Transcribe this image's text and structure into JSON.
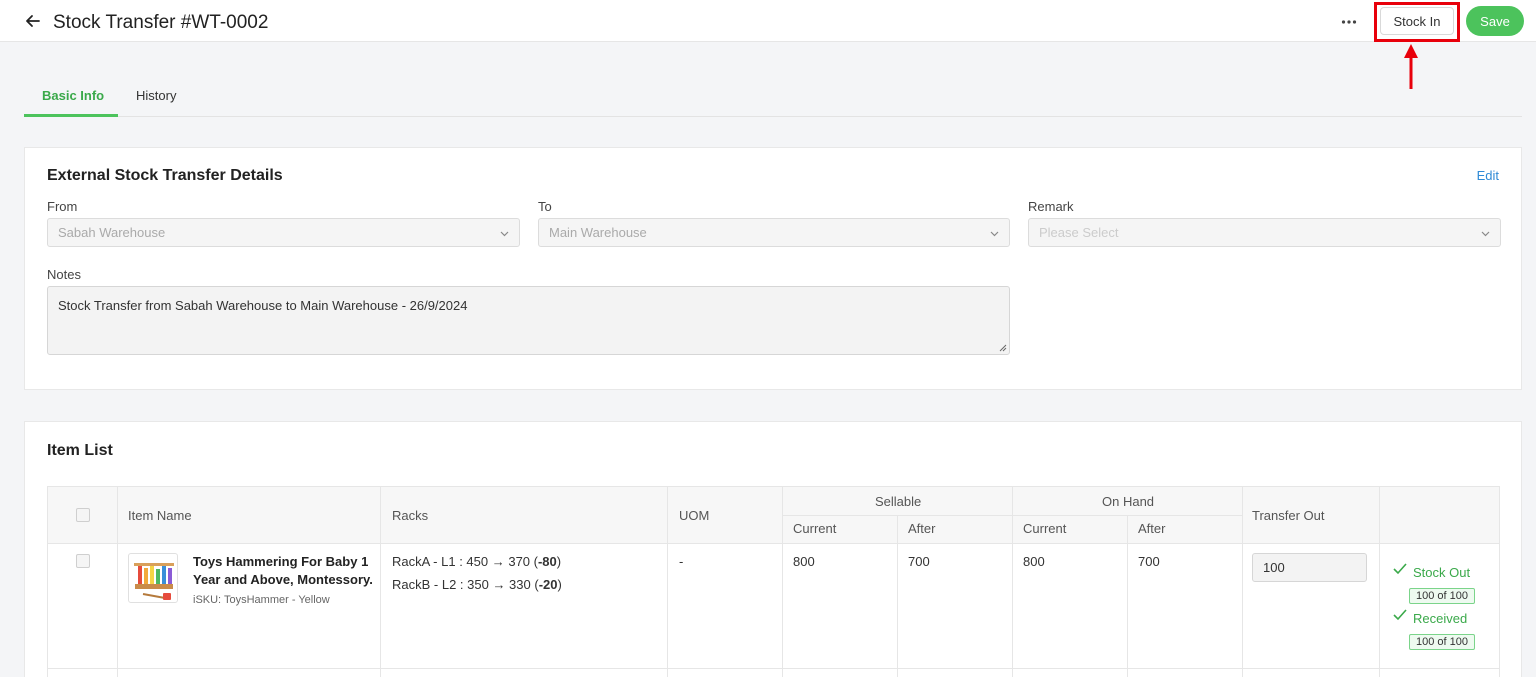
{
  "header": {
    "title": "Stock Transfer #WT-0002",
    "stock_in_label": "Stock In",
    "save_label": "Save"
  },
  "tabs": [
    {
      "label": "Basic Info",
      "active": true
    },
    {
      "label": "History",
      "active": false
    }
  ],
  "details": {
    "title": "External Stock Transfer Details",
    "edit_label": "Edit",
    "from_label": "From",
    "from_value": "Sabah Warehouse",
    "to_label": "To",
    "to_value": "Main Warehouse",
    "remark_label": "Remark",
    "remark_placeholder": "Please Select",
    "notes_label": "Notes",
    "notes_value": "Stock Transfer from Sabah Warehouse to Main Warehouse - 26/9/2024"
  },
  "item_list": {
    "title": "Item List",
    "columns": {
      "item_name": "Item Name",
      "racks": "Racks",
      "uom": "UOM",
      "sellable": "Sellable",
      "on_hand": "On Hand",
      "current": "Current",
      "after": "After",
      "transfer_out": "Transfer Out"
    },
    "rows": [
      {
        "name": "Toys Hammering For Baby 1 Year and Above, Montessory...",
        "name_line1": "Toys Hammering For Baby 1",
        "name_line2": "Year and Above, Montessory...",
        "sku": "iSKU: ToysHammer - Yellow",
        "racks": [
          {
            "prefix": "RackA - L1 : 450 → 370 (",
            "delta": "-80",
            "suffix": ")"
          },
          {
            "prefix": "RackB - L2 : 350 → 330 (",
            "delta": "-20",
            "suffix": ")"
          }
        ],
        "uom": "-",
        "sellable_current": "800",
        "sellable_after": "700",
        "onhand_current": "800",
        "onhand_after": "700",
        "transfer_out": "100",
        "stock_out_label": "Stock Out",
        "stock_out_count": "100 of 100",
        "received_label": "Received",
        "received_count": "100 of 100"
      }
    ]
  },
  "colors": {
    "accent": "#4cc35c",
    "highlight": "#e8000b",
    "link": "#2f8ad6"
  }
}
